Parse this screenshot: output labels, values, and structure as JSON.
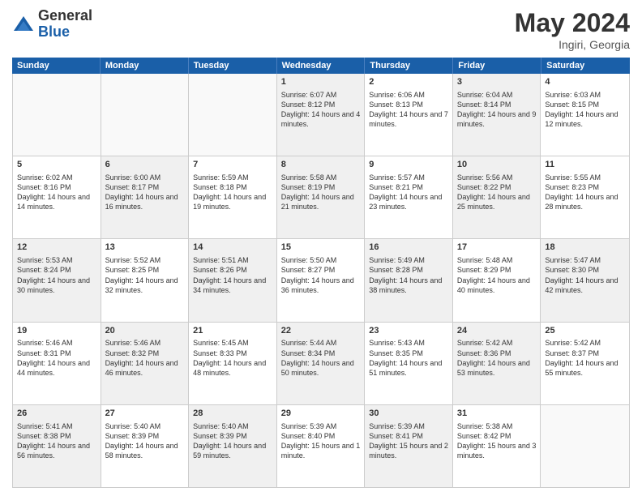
{
  "header": {
    "logo_general": "General",
    "logo_blue": "Blue",
    "title": "May 2024",
    "location": "Ingiri, Georgia"
  },
  "weekdays": [
    "Sunday",
    "Monday",
    "Tuesday",
    "Wednesday",
    "Thursday",
    "Friday",
    "Saturday"
  ],
  "rows": [
    [
      {
        "day": "",
        "sunrise": "",
        "sunset": "",
        "daylight": "",
        "empty": true
      },
      {
        "day": "",
        "sunrise": "",
        "sunset": "",
        "daylight": "",
        "empty": true
      },
      {
        "day": "",
        "sunrise": "",
        "sunset": "",
        "daylight": "",
        "empty": true
      },
      {
        "day": "1",
        "sunrise": "Sunrise: 6:07 AM",
        "sunset": "Sunset: 8:12 PM",
        "daylight": "Daylight: 14 hours and 4 minutes.",
        "shaded": true
      },
      {
        "day": "2",
        "sunrise": "Sunrise: 6:06 AM",
        "sunset": "Sunset: 8:13 PM",
        "daylight": "Daylight: 14 hours and 7 minutes."
      },
      {
        "day": "3",
        "sunrise": "Sunrise: 6:04 AM",
        "sunset": "Sunset: 8:14 PM",
        "daylight": "Daylight: 14 hours and 9 minutes.",
        "shaded": true
      },
      {
        "day": "4",
        "sunrise": "Sunrise: 6:03 AM",
        "sunset": "Sunset: 8:15 PM",
        "daylight": "Daylight: 14 hours and 12 minutes."
      }
    ],
    [
      {
        "day": "5",
        "sunrise": "Sunrise: 6:02 AM",
        "sunset": "Sunset: 8:16 PM",
        "daylight": "Daylight: 14 hours and 14 minutes."
      },
      {
        "day": "6",
        "sunrise": "Sunrise: 6:00 AM",
        "sunset": "Sunset: 8:17 PM",
        "daylight": "Daylight: 14 hours and 16 minutes.",
        "shaded": true
      },
      {
        "day": "7",
        "sunrise": "Sunrise: 5:59 AM",
        "sunset": "Sunset: 8:18 PM",
        "daylight": "Daylight: 14 hours and 19 minutes."
      },
      {
        "day": "8",
        "sunrise": "Sunrise: 5:58 AM",
        "sunset": "Sunset: 8:19 PM",
        "daylight": "Daylight: 14 hours and 21 minutes.",
        "shaded": true
      },
      {
        "day": "9",
        "sunrise": "Sunrise: 5:57 AM",
        "sunset": "Sunset: 8:21 PM",
        "daylight": "Daylight: 14 hours and 23 minutes."
      },
      {
        "day": "10",
        "sunrise": "Sunrise: 5:56 AM",
        "sunset": "Sunset: 8:22 PM",
        "daylight": "Daylight: 14 hours and 25 minutes.",
        "shaded": true
      },
      {
        "day": "11",
        "sunrise": "Sunrise: 5:55 AM",
        "sunset": "Sunset: 8:23 PM",
        "daylight": "Daylight: 14 hours and 28 minutes."
      }
    ],
    [
      {
        "day": "12",
        "sunrise": "Sunrise: 5:53 AM",
        "sunset": "Sunset: 8:24 PM",
        "daylight": "Daylight: 14 hours and 30 minutes.",
        "shaded": true
      },
      {
        "day": "13",
        "sunrise": "Sunrise: 5:52 AM",
        "sunset": "Sunset: 8:25 PM",
        "daylight": "Daylight: 14 hours and 32 minutes."
      },
      {
        "day": "14",
        "sunrise": "Sunrise: 5:51 AM",
        "sunset": "Sunset: 8:26 PM",
        "daylight": "Daylight: 14 hours and 34 minutes.",
        "shaded": true
      },
      {
        "day": "15",
        "sunrise": "Sunrise: 5:50 AM",
        "sunset": "Sunset: 8:27 PM",
        "daylight": "Daylight: 14 hours and 36 minutes."
      },
      {
        "day": "16",
        "sunrise": "Sunrise: 5:49 AM",
        "sunset": "Sunset: 8:28 PM",
        "daylight": "Daylight: 14 hours and 38 minutes.",
        "shaded": true
      },
      {
        "day": "17",
        "sunrise": "Sunrise: 5:48 AM",
        "sunset": "Sunset: 8:29 PM",
        "daylight": "Daylight: 14 hours and 40 minutes."
      },
      {
        "day": "18",
        "sunrise": "Sunrise: 5:47 AM",
        "sunset": "Sunset: 8:30 PM",
        "daylight": "Daylight: 14 hours and 42 minutes.",
        "shaded": true
      }
    ],
    [
      {
        "day": "19",
        "sunrise": "Sunrise: 5:46 AM",
        "sunset": "Sunset: 8:31 PM",
        "daylight": "Daylight: 14 hours and 44 minutes."
      },
      {
        "day": "20",
        "sunrise": "Sunrise: 5:46 AM",
        "sunset": "Sunset: 8:32 PM",
        "daylight": "Daylight: 14 hours and 46 minutes.",
        "shaded": true
      },
      {
        "day": "21",
        "sunrise": "Sunrise: 5:45 AM",
        "sunset": "Sunset: 8:33 PM",
        "daylight": "Daylight: 14 hours and 48 minutes."
      },
      {
        "day": "22",
        "sunrise": "Sunrise: 5:44 AM",
        "sunset": "Sunset: 8:34 PM",
        "daylight": "Daylight: 14 hours and 50 minutes.",
        "shaded": true
      },
      {
        "day": "23",
        "sunrise": "Sunrise: 5:43 AM",
        "sunset": "Sunset: 8:35 PM",
        "daylight": "Daylight: 14 hours and 51 minutes."
      },
      {
        "day": "24",
        "sunrise": "Sunrise: 5:42 AM",
        "sunset": "Sunset: 8:36 PM",
        "daylight": "Daylight: 14 hours and 53 minutes.",
        "shaded": true
      },
      {
        "day": "25",
        "sunrise": "Sunrise: 5:42 AM",
        "sunset": "Sunset: 8:37 PM",
        "daylight": "Daylight: 14 hours and 55 minutes."
      }
    ],
    [
      {
        "day": "26",
        "sunrise": "Sunrise: 5:41 AM",
        "sunset": "Sunset: 8:38 PM",
        "daylight": "Daylight: 14 hours and 56 minutes.",
        "shaded": true
      },
      {
        "day": "27",
        "sunrise": "Sunrise: 5:40 AM",
        "sunset": "Sunset: 8:39 PM",
        "daylight": "Daylight: 14 hours and 58 minutes."
      },
      {
        "day": "28",
        "sunrise": "Sunrise: 5:40 AM",
        "sunset": "Sunset: 8:39 PM",
        "daylight": "Daylight: 14 hours and 59 minutes.",
        "shaded": true
      },
      {
        "day": "29",
        "sunrise": "Sunrise: 5:39 AM",
        "sunset": "Sunset: 8:40 PM",
        "daylight": "Daylight: 15 hours and 1 minute."
      },
      {
        "day": "30",
        "sunrise": "Sunrise: 5:39 AM",
        "sunset": "Sunset: 8:41 PM",
        "daylight": "Daylight: 15 hours and 2 minutes.",
        "shaded": true
      },
      {
        "day": "31",
        "sunrise": "Sunrise: 5:38 AM",
        "sunset": "Sunset: 8:42 PM",
        "daylight": "Daylight: 15 hours and 3 minutes."
      },
      {
        "day": "",
        "sunrise": "",
        "sunset": "",
        "daylight": "",
        "empty": true
      }
    ]
  ]
}
